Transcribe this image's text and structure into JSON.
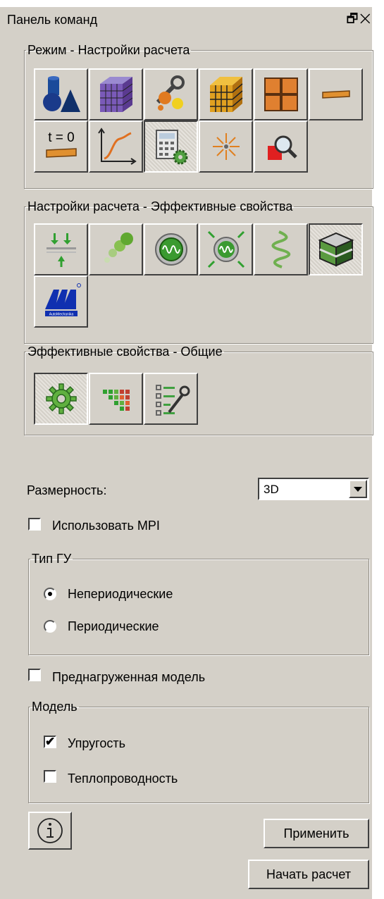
{
  "panel": {
    "title": "Панель команд",
    "float_icon": "float-window-icon",
    "close_icon": "close-icon"
  },
  "groups": {
    "mode": {
      "legend": "Режим - Настройки расчета"
    },
    "calc": {
      "legend": "Настройки расчета - Эффективные свойства"
    },
    "eff": {
      "legend": "Эффективные свойства - Общие"
    }
  },
  "mode_buttons": [
    {
      "icon": "geometry-shapes-icon",
      "pressed": false
    },
    {
      "icon": "mesh-cube-icon",
      "pressed": false
    },
    {
      "icon": "material-settings-icon",
      "pressed": false
    },
    {
      "icon": "voxel-cube-icon",
      "pressed": false
    },
    {
      "icon": "grid-icon",
      "pressed": false
    },
    {
      "icon": "beam-icon",
      "pressed": false
    },
    {
      "icon": "initial-state-icon",
      "text": "t = 0",
      "pressed": false
    },
    {
      "icon": "curve-graph-icon",
      "pressed": false
    },
    {
      "icon": "calculator-settings-icon",
      "pressed": true
    },
    {
      "icon": "sunburst-icon",
      "pressed": false
    },
    {
      "icon": "magnify-results-icon",
      "pressed": false
    }
  ],
  "calc_buttons": [
    {
      "icon": "compression-load-icon",
      "pressed": false
    },
    {
      "icon": "particles-icon",
      "pressed": false
    },
    {
      "icon": "oscillation-icon",
      "pressed": false
    },
    {
      "icon": "oscillation-load-icon",
      "pressed": false
    },
    {
      "icon": "spring-icon",
      "pressed": false
    },
    {
      "icon": "layered-cube-icon",
      "pressed": true
    },
    {
      "icon": "automechanika-logo-icon",
      "logo_text": "AutoMechanika",
      "pressed": false
    }
  ],
  "eff_buttons": [
    {
      "icon": "gear-icon",
      "pressed": true
    },
    {
      "icon": "color-matrix-icon",
      "pressed": false
    },
    {
      "icon": "list-settings-icon",
      "pressed": false
    }
  ],
  "dimension": {
    "label": "Размерность:",
    "value": "3D"
  },
  "use_mpi": {
    "label": "Использовать MPI",
    "checked": false
  },
  "bc_type": {
    "legend": "Тип ГУ",
    "options": [
      {
        "label": "Непериодические",
        "selected": true
      },
      {
        "label": "Периодические",
        "selected": false
      }
    ]
  },
  "preloaded": {
    "label": "Преднагруженная модель",
    "checked": false
  },
  "model": {
    "legend": "Модель",
    "options": [
      {
        "label": "Упругость",
        "checked": true
      },
      {
        "label": "Теплопроводность",
        "checked": false
      }
    ]
  },
  "buttons": {
    "info_icon": "info-icon",
    "apply": "Применить",
    "start": "Начать расчет"
  },
  "colors": {
    "panel_bg": "#d4d0c8",
    "accent_orange": "#e8a030",
    "accent_green": "#40a040",
    "accent_blue": "#1a3a8a"
  }
}
